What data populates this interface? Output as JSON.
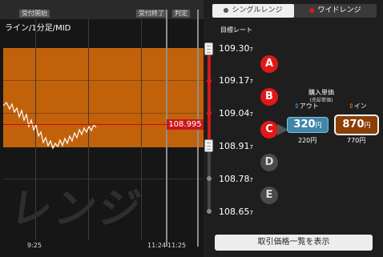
{
  "chart": {
    "start_label": "受付開始",
    "end_label": "受付終了",
    "judge_label": "判定",
    "title": "ライン/1分足/MID",
    "current_price": "108.995",
    "watermark": "レンジ",
    "x_labels": [
      "9:25",
      "11:24",
      "11:25"
    ]
  },
  "tabs": [
    {
      "label": "シングルレンジ",
      "active": true,
      "dot_color": "#555555"
    },
    {
      "label": "ワイドレンジ",
      "active": false,
      "dot_color": "#e01818"
    }
  ],
  "rate_title": "目標レート",
  "rates": [
    {
      "main": "109.30",
      "sub": "7"
    },
    {
      "main": "109.17",
      "sub": "7"
    },
    {
      "main": "109.04",
      "sub": "7"
    },
    {
      "main": "108.91",
      "sub": "7"
    },
    {
      "main": "108.78",
      "sub": "7"
    },
    {
      "main": "108.65",
      "sub": "7"
    }
  ],
  "ranges": [
    {
      "label": "A",
      "active": true
    },
    {
      "label": "B",
      "active": true
    },
    {
      "label": "C",
      "active": true
    },
    {
      "label": "D",
      "active": false
    },
    {
      "label": "E",
      "active": false
    }
  ],
  "purchase": {
    "title": "購入単価",
    "subtitle": "(売却単価)",
    "out_label": "アウト",
    "in_label": "イン",
    "out_price": "320",
    "in_price": "870",
    "yen": "円",
    "out_sell": "220円",
    "in_sell": "770円"
  },
  "list_button": "取引価格一覧を表示",
  "colors": {
    "accent": "#e01818",
    "band": "#c1620b",
    "out": "#3f86a8",
    "in": "#8a3f06"
  }
}
